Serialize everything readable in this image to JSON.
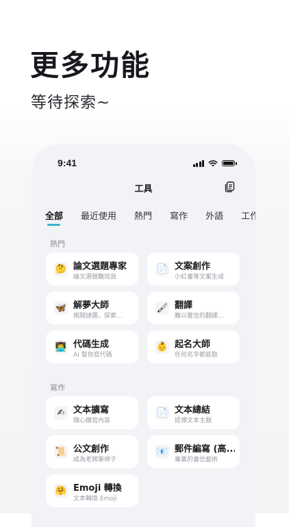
{
  "headline": "更多功能",
  "subline": "等待探索~",
  "status": {
    "time": "9:41"
  },
  "nav": {
    "title": "工具"
  },
  "tabs": [
    "全部",
    "最近使用",
    "熱門",
    "寫作",
    "外語",
    "工作"
  ],
  "sections": {
    "hot": {
      "label": "熱門",
      "cards": [
        {
          "title": "論文選題專家",
          "desc": "論文選題難找我",
          "icon": "thinking-face-icon",
          "glyph": "🤔"
        },
        {
          "title": "文案創作",
          "desc": "小紅書等文案生成",
          "icon": "document-icon",
          "glyph": "📄"
        },
        {
          "title": "解夢大師",
          "desc": "揭開謎團，探索...",
          "icon": "butterfly-icon",
          "glyph": "🦋"
        },
        {
          "title": "翻譯",
          "desc": "難以置信的翻譯...",
          "icon": "brush-icon",
          "glyph": "🖌"
        },
        {
          "title": "代碼生成",
          "desc": "AI 幫你寫代碼",
          "icon": "technologist-icon",
          "glyph": "👨‍💻"
        },
        {
          "title": "起名大師",
          "desc": "任何名字都能取",
          "icon": "baby-icon",
          "glyph": "👶"
        }
      ]
    },
    "writing": {
      "label": "寫作",
      "cards": [
        {
          "title": "文本擴寫",
          "desc": "隨心擴寫內容",
          "icon": "pen-icon",
          "glyph": "✍"
        },
        {
          "title": "文本總結",
          "desc": "提煉文本主題",
          "icon": "document-icon",
          "glyph": "📄"
        },
        {
          "title": "公文創作",
          "desc": "成為老牌筆桿子",
          "icon": "scroll-icon",
          "glyph": "📜"
        },
        {
          "title": "郵件編寫 (高...",
          "desc": "專業的書信藝術",
          "icon": "mail-icon",
          "glyph": "📧"
        },
        {
          "title": "Emoji 轉換",
          "desc": "文本轉換 Emoji",
          "icon": "hugging-face-icon",
          "glyph": "🤗"
        }
      ]
    }
  }
}
